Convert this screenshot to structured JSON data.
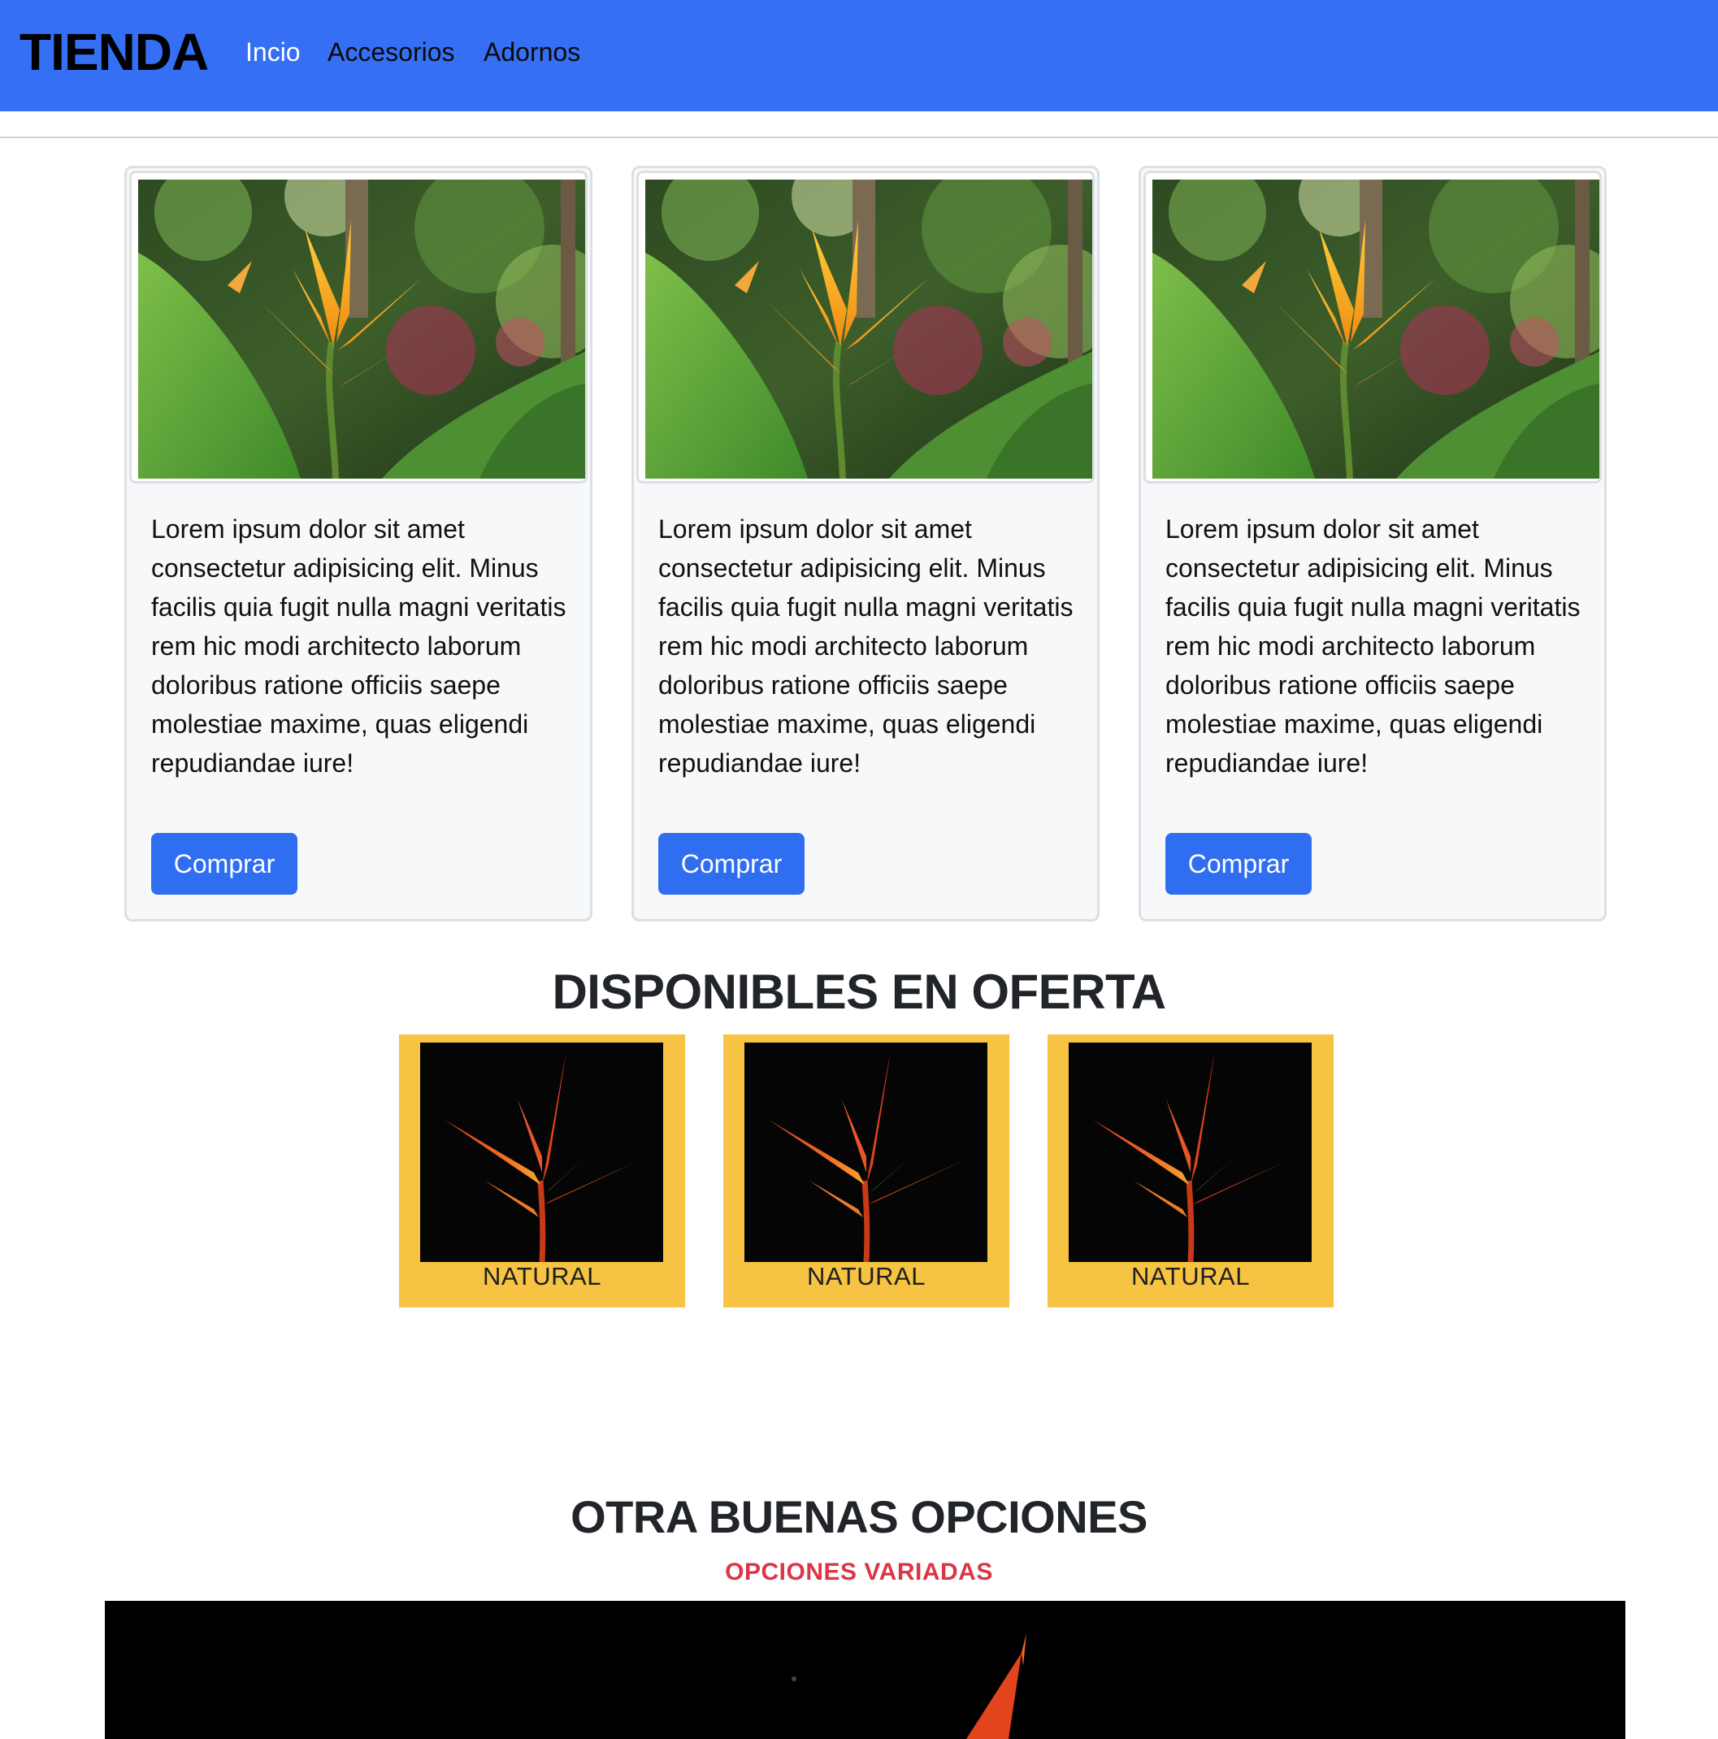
{
  "navbar": {
    "brand": "TIENDA",
    "links": [
      {
        "label": "Incio",
        "active": true
      },
      {
        "label": "Accesorios",
        "active": false
      },
      {
        "label": "Adornos",
        "active": false
      }
    ]
  },
  "products": [
    {
      "description": "Lorem ipsum dolor sit amet consectetur adipisicing elit. Minus facilis quia fugit nulla magni veritatis rem hic modi architecto laborum doloribus ratione officiis saepe molestiae maxime, quas eligendi repudiandae iure!",
      "button": "Comprar"
    },
    {
      "description": "Lorem ipsum dolor sit amet consectetur adipisicing elit. Minus facilis quia fugit nulla magni veritatis rem hic modi architecto laborum doloribus ratione officiis saepe molestiae maxime, quas eligendi repudiandae iure!",
      "button": "Comprar"
    },
    {
      "description": "Lorem ipsum dolor sit amet consectetur adipisicing elit. Minus facilis quia fugit nulla magni veritatis rem hic modi architecto laborum doloribus ratione officiis saepe molestiae maxime, quas eligendi repudiandae iure!",
      "button": "Comprar"
    }
  ],
  "offers": {
    "title": "DISPONIBLES EN OFERTA",
    "items": [
      {
        "label": "NATURAL"
      },
      {
        "label": "NATURAL"
      },
      {
        "label": "NATURAL"
      }
    ]
  },
  "other": {
    "title": "OTRA BUENAS OPCIONES",
    "subtitle": "OPCIONES VARIADAS"
  },
  "colors": {
    "navbar": "#356ff3",
    "button": "#2f6ef0",
    "offer_bg": "#f6c343",
    "subtitle": "#dc3545"
  }
}
